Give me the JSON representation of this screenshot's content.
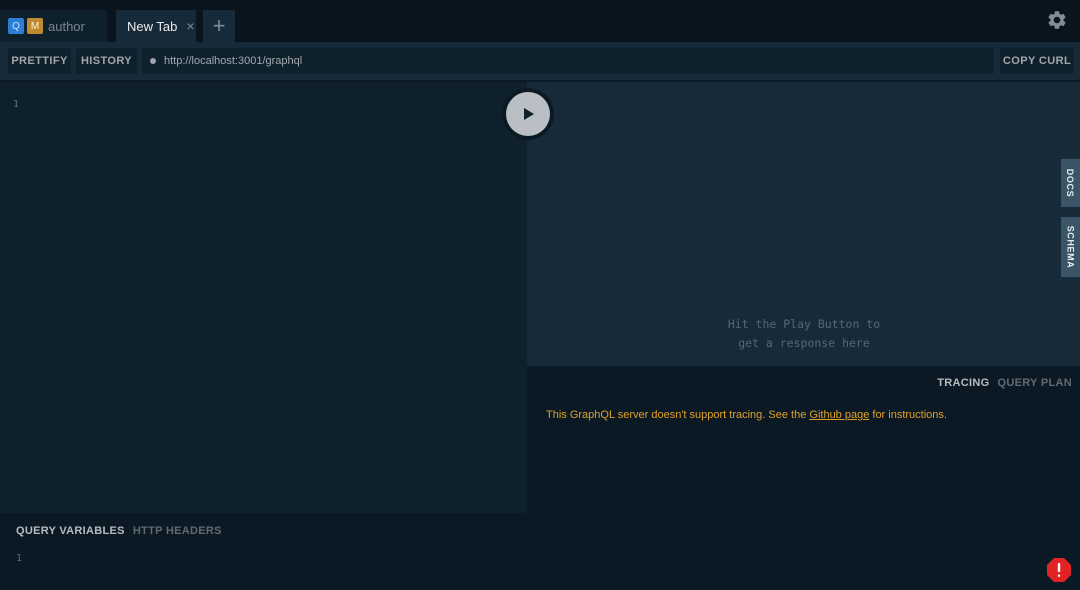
{
  "tabs": [
    {
      "badges": [
        "Q",
        "M"
      ],
      "label": "author",
      "active": false
    },
    {
      "label": "New Tab",
      "active": true,
      "close": "×"
    }
  ],
  "add_tab_label": "+",
  "toolbar": {
    "prettify_label": "PRETTIFY",
    "history_label": "HISTORY",
    "endpoint_url": "http://localhost:3001/graphql",
    "copy_curl_label": "COPY CURL"
  },
  "editor": {
    "line_number": "1"
  },
  "result": {
    "hint_line1": "Hit the Play Button to",
    "hint_line2": "get a response here",
    "docs_label": "DOCS",
    "schema_label": "SCHEMA"
  },
  "tracing": {
    "tab_tracing": "TRACING",
    "tab_query_plan": "QUERY PLAN",
    "message_before": "This GraphQL server doesn't support tracing. See the ",
    "message_link": "Github page",
    "message_after": " for instructions."
  },
  "variables": {
    "tab_query_variables": "QUERY VARIABLES",
    "tab_http_headers": "HTTP HEADERS",
    "line_number": "1"
  },
  "icons": {
    "settings": "gear-icon",
    "play": "play-icon",
    "error": "error-icon"
  },
  "colors": {
    "accent_warning": "#e0a12a",
    "error_red": "#e02424",
    "badge_query": "#2a7ed3",
    "badge_mutation": "#c08b30"
  }
}
